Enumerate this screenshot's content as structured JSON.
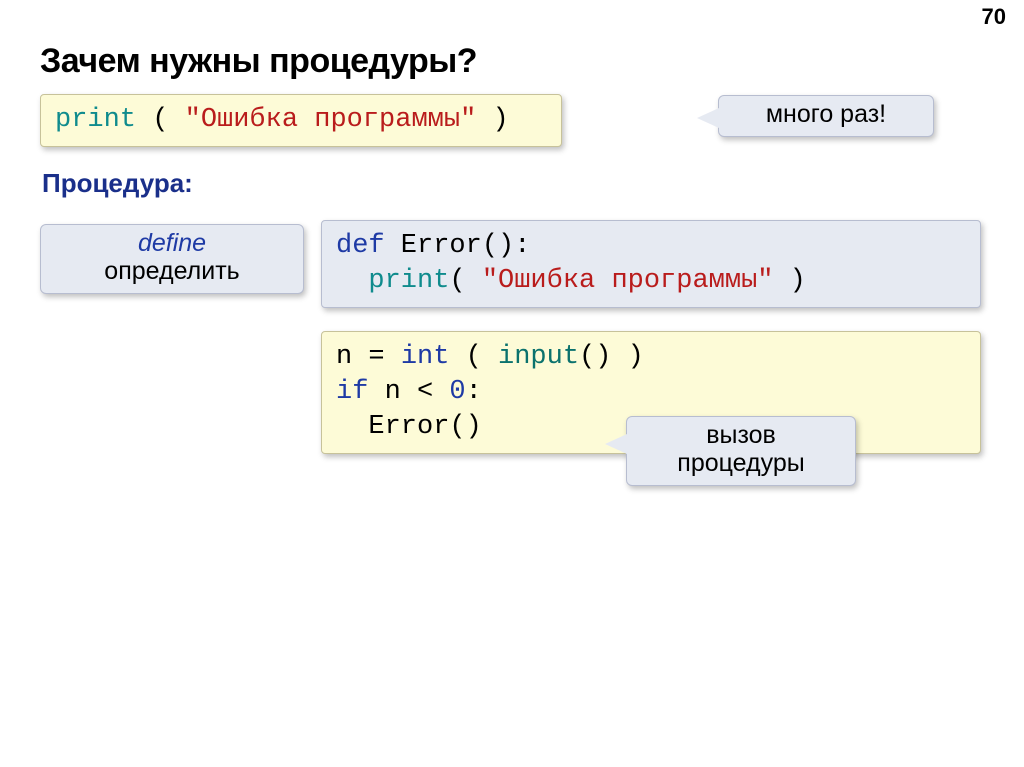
{
  "page_number": "70",
  "title": "Зачем нужны процедуры?",
  "subtitle": "Процедура:",
  "callouts": {
    "many_times": "много раз!",
    "define_en": "define",
    "define_ru": "определить",
    "call_l1": "вызов",
    "call_l2": "процедуры"
  },
  "code1": {
    "t_print": "print",
    "t_open": " ( ",
    "t_str": "\"Ошибка программы\"",
    "t_close": " )"
  },
  "code2": {
    "l1_def": "def",
    "l1_rest": " Error():",
    "l2_indent": "  ",
    "l2_print": "print",
    "l2_open": "( ",
    "l2_str": "\"Ошибка программы\"",
    "l2_close": " )"
  },
  "code3": {
    "l1_a": "n = ",
    "l1_b": "int",
    "l1_c": " ( ",
    "l1_d": "input",
    "l1_e": "()",
    "l1_f": " )",
    "l2_a": "if",
    "l2_b": " n < ",
    "l2_c": "0",
    "l2_d": ":",
    "l3_a": "  Error()"
  }
}
